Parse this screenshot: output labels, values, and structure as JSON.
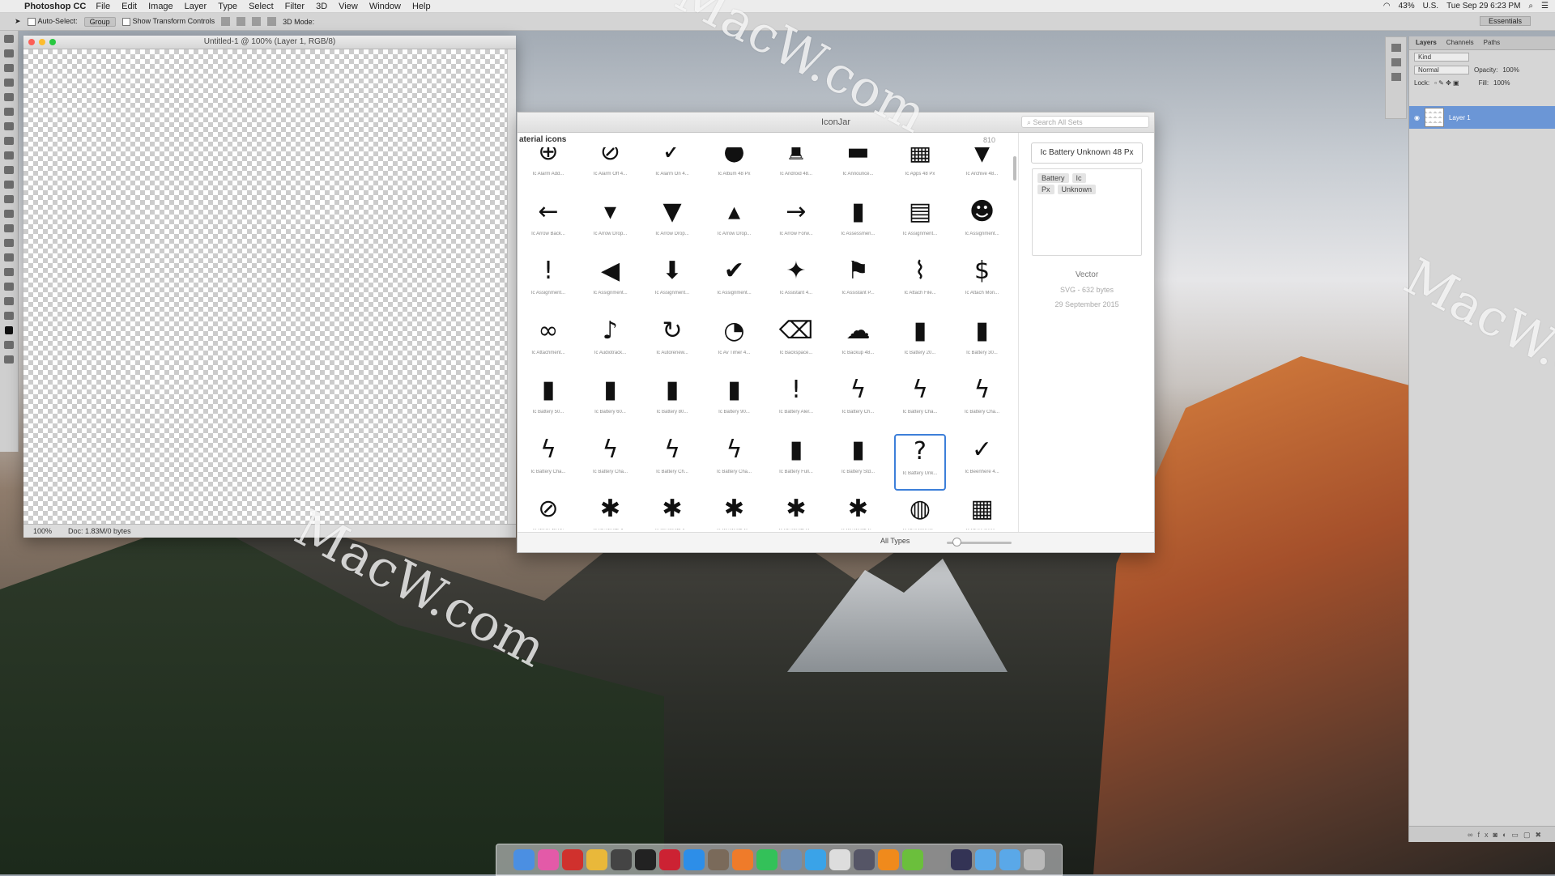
{
  "menubar": {
    "app": "Photoshop CC",
    "items": [
      "File",
      "Edit",
      "Image",
      "Layer",
      "Type",
      "Select",
      "Filter",
      "3D",
      "View",
      "Window",
      "Help"
    ],
    "battery": "43%",
    "input": "U.S.",
    "clock": "Tue Sep 29  6:23 PM"
  },
  "options": {
    "auto_select": "Auto-Select:",
    "group": "Group",
    "transform": "Show Transform Controls",
    "mode3d": "3D Mode:",
    "workspace": "Essentials"
  },
  "document": {
    "title": "Untitled-1 @ 100% (Layer 1, RGB/8)",
    "zoom": "100%",
    "doc_size": "Doc: 1.83M/0 bytes"
  },
  "iconjar": {
    "title": "IconJar",
    "search_placeholder": "Search All Sets",
    "set_name": "aterial icons",
    "set_count": "810",
    "icons": [
      {
        "g": "⊕",
        "l": "Ic Alarm Add..."
      },
      {
        "g": "⊘",
        "l": "Ic Alarm Off 4..."
      },
      {
        "g": "✓",
        "l": "Ic Alarm On 4..."
      },
      {
        "g": "●",
        "l": "Ic Album 48 Px"
      },
      {
        "g": "♜",
        "l": "Ic Android 48..."
      },
      {
        "g": "▬",
        "l": "Ic Announce..."
      },
      {
        "g": "▦",
        "l": "Ic Apps 48 Px"
      },
      {
        "g": "▼",
        "l": "Ic Archive 48..."
      },
      {
        "g": "←",
        "l": "Ic Arrow Back..."
      },
      {
        "g": "▾",
        "l": "Ic Arrow Drop..."
      },
      {
        "g": "▼",
        "l": "Ic Arrow Drop..."
      },
      {
        "g": "▴",
        "l": "Ic Arrow Drop..."
      },
      {
        "g": "→",
        "l": "Ic Arrow Forw..."
      },
      {
        "g": "▮",
        "l": "Ic Assessmen..."
      },
      {
        "g": "▤",
        "l": "Ic Assignment..."
      },
      {
        "g": "☻",
        "l": "Ic Assignment..."
      },
      {
        "g": "!",
        "l": "Ic Assignment..."
      },
      {
        "g": "◀",
        "l": "Ic Assignment..."
      },
      {
        "g": "⬇",
        "l": "Ic Assignment..."
      },
      {
        "g": "✔",
        "l": "Ic Assignment..."
      },
      {
        "g": "✦",
        "l": "Ic Assistant 4..."
      },
      {
        "g": "⚑",
        "l": "Ic Assistant P..."
      },
      {
        "g": "⌇",
        "l": "Ic Attach File..."
      },
      {
        "g": "$",
        "l": "Ic Attach Mon..."
      },
      {
        "g": "∞",
        "l": "Ic Attachment..."
      },
      {
        "g": "♪",
        "l": "Ic Audiotrack..."
      },
      {
        "g": "↻",
        "l": "Ic Autorenew..."
      },
      {
        "g": "◔",
        "l": "Ic Av Timer 4..."
      },
      {
        "g": "⌫",
        "l": "Ic Backspace..."
      },
      {
        "g": "☁",
        "l": "Ic Backup 48..."
      },
      {
        "g": "▮",
        "l": "Ic Battery 20..."
      },
      {
        "g": "▮",
        "l": "Ic Battery 30..."
      },
      {
        "g": "▮",
        "l": "Ic Battery 50..."
      },
      {
        "g": "▮",
        "l": "Ic Battery 60..."
      },
      {
        "g": "▮",
        "l": "Ic Battery 80..."
      },
      {
        "g": "▮",
        "l": "Ic Battery 90..."
      },
      {
        "g": "!",
        "l": "Ic Battery Aler..."
      },
      {
        "g": "ϟ",
        "l": "Ic Battery Ch..."
      },
      {
        "g": "ϟ",
        "l": "Ic Battery Cha..."
      },
      {
        "g": "ϟ",
        "l": "Ic Battery Cha..."
      },
      {
        "g": "ϟ",
        "l": "Ic Battery Cha..."
      },
      {
        "g": "ϟ",
        "l": "Ic Battery Cha..."
      },
      {
        "g": "ϟ",
        "l": "Ic Battery Ch..."
      },
      {
        "g": "ϟ",
        "l": "Ic Battery Cha..."
      },
      {
        "g": "▮",
        "l": "Ic Battery Full..."
      },
      {
        "g": "▮",
        "l": "Ic Battery Std..."
      },
      {
        "g": "?",
        "l": "Ic Battery Unk..."
      },
      {
        "g": "✓",
        "l": "Ic Beenhere 4..."
      },
      {
        "g": "⊘",
        "l": "Ic Block 48 Px"
      },
      {
        "g": "✱",
        "l": "Ic Bluetooth 4..."
      },
      {
        "g": "✱",
        "l": "Ic Bluetooth A..."
      },
      {
        "g": "✱",
        "l": "Ic Bluetooth C..."
      },
      {
        "g": "✱",
        "l": "Ic Bluetooth D..."
      },
      {
        "g": "✱",
        "l": "Ic Bluetooth S..."
      },
      {
        "g": "◍",
        "l": "Ic Blur Circula..."
      },
      {
        "g": "▦",
        "l": "Ic Blur Linear..."
      }
    ],
    "selected_name": "Ic Battery Unknown 48 Px",
    "tags": [
      "Battery",
      "Ic",
      "Px",
      "Unknown"
    ],
    "type": "Vector",
    "size": "SVG - 632 bytes",
    "date": "29 September 2015",
    "filter": "All Types"
  },
  "layers": {
    "tabs": [
      "Layers",
      "Channels",
      "Paths"
    ],
    "kind": "Kind",
    "blend": "Normal",
    "opacity_label": "Opacity:",
    "opacity": "100%",
    "lock_label": "Lock:",
    "fill_label": "Fill:",
    "fill": "100%",
    "layer_name": "Layer 1",
    "footer": "fx"
  },
  "watermark": "MacW.com",
  "colors": {
    "accent": "#3d7fd9",
    "layer_sel": "#6b96d6"
  }
}
